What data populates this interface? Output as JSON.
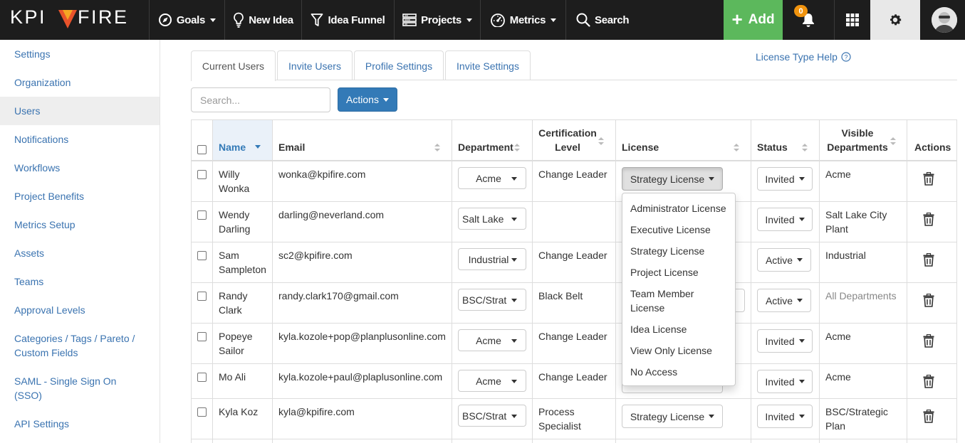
{
  "nav": {
    "logo_left": "KPI",
    "logo_right": "FIRE",
    "goals": "Goals",
    "new_idea": "New Idea",
    "idea_funnel": "Idea Funnel",
    "projects": "Projects",
    "metrics": "Metrics",
    "search": "Search",
    "add": "Add",
    "notification_count": "0",
    "accent_add": "#5cb85c"
  },
  "sidebar": {
    "items": [
      "Settings",
      "Organization",
      "Users",
      "Notifications",
      "Workflows",
      "Project Benefits",
      "Metrics Setup",
      "Assets",
      "Teams",
      "Approval Levels",
      "Categories / Tags / Pareto / Custom Fields",
      "SAML - Single Sign On (SSO)",
      "API Settings"
    ],
    "active": "Users"
  },
  "tabs": [
    "Current Users",
    "Invite Users",
    "Profile Settings",
    "Invite Settings"
  ],
  "help_link": "License Type Help",
  "toolbar": {
    "search_placeholder": "Search...",
    "actions_label": "Actions"
  },
  "table": {
    "headers": {
      "name": "Name",
      "email": "Email",
      "department": "Department",
      "cert_line1": "Certification",
      "cert_line2": "Level",
      "license": "License",
      "status": "Status",
      "visible_line1": "Visible",
      "visible_line2": "Departments",
      "actions": "Actions"
    },
    "rows": [
      {
        "name1": "Willy",
        "name2": "Wonka",
        "email": "wonka@kpifire.com",
        "department": "Acme",
        "cert1": "Change Leader",
        "cert2": "",
        "license": "Strategy License",
        "status": "Invited",
        "visible1": "Acme",
        "visible2": ""
      },
      {
        "name1": "Wendy",
        "name2": "Darling",
        "email": "darling@neverland.com",
        "department": "Salt Lake ...",
        "cert1": "",
        "cert2": "",
        "license": "",
        "status": "Invited",
        "visible1": "Salt Lake City",
        "visible2": "Plant"
      },
      {
        "name1": "Sam",
        "name2": "Sampleton",
        "email": "sc2@kpifire.com",
        "department": "Industrial",
        "cert1": "Change Leader",
        "cert2": "",
        "license": "",
        "status": "Active",
        "visible1": "Industrial",
        "visible2": ""
      },
      {
        "name1": "Randy",
        "name2": "Clark",
        "email": "randy.clark170@gmail.com",
        "department": "BSC/Strat...",
        "cert1": "Black Belt",
        "cert2": "",
        "license": "",
        "status": "Active",
        "visible1": "All Departments",
        "visible2": ""
      },
      {
        "name1": "Popeye",
        "name2": "Sailor",
        "email": "kyla.kozole+pop@planplusonline.com",
        "department": "Acme",
        "cert1": "Change Leader",
        "cert2": "",
        "license": "",
        "status": "Invited",
        "visible1": "Acme",
        "visible2": ""
      },
      {
        "name1": "Mo Ali",
        "name2": "",
        "email": "kyla.kozole+paul@plaplusonline.com",
        "department": "Acme",
        "cert1": "Change Leader",
        "cert2": "",
        "license": "",
        "status": "Invited",
        "visible1": "Acme",
        "visible2": ""
      },
      {
        "name1": "Kyla Koz",
        "name2": "",
        "email": "kyla@kpifire.com",
        "department": "BSC/Strat...",
        "cert1": "Process",
        "cert2": "Specialist",
        "license": "Strategy License",
        "status": "Invited",
        "visible1": "BSC/Strategic",
        "visible2": "Plan"
      }
    ]
  },
  "license_menu": {
    "items": [
      "Administrator License",
      "Executive License",
      "Strategy License",
      "Project License",
      "Team Member",
      "License",
      "Idea License",
      "View Only License",
      "No Access"
    ]
  }
}
